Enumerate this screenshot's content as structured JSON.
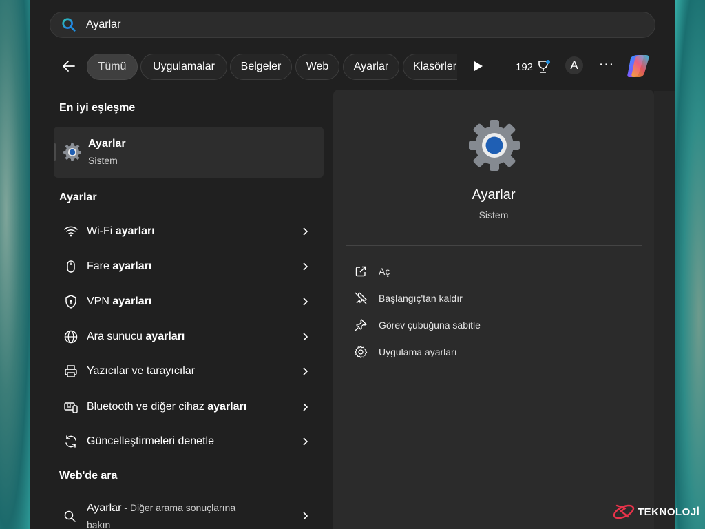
{
  "search": {
    "value": "Ayarlar",
    "icon": "search-icon"
  },
  "filters": {
    "tabs": [
      {
        "label": "Tümü",
        "active": true
      },
      {
        "label": "Uygulamalar"
      },
      {
        "label": "Belgeler"
      },
      {
        "label": "Web"
      },
      {
        "label": "Ayarlar"
      },
      {
        "label": "Klasörler"
      }
    ],
    "points": "192",
    "avatar_letter": "A"
  },
  "results": {
    "best_match_title": "En iyi eşleşme",
    "best_match": {
      "name": "Ayarlar",
      "subtitle": "Sistem"
    },
    "settings_title": "Ayarlar",
    "settings_items": [
      {
        "pre": "Wi-Fi ",
        "bold": "ayarları",
        "icon": "wifi-icon"
      },
      {
        "pre": "Fare ",
        "bold": "ayarları",
        "icon": "mouse-icon"
      },
      {
        "pre": "VPN ",
        "bold": "ayarları",
        "icon": "vpn-shield-icon"
      },
      {
        "pre": "Ara sunucu ",
        "bold": "ayarları",
        "icon": "globe-icon"
      },
      {
        "pre": "Yazıcılar ve tarayıcılar",
        "bold": "",
        "icon": "printer-icon"
      },
      {
        "pre": "Bluetooth ve diğer cihaz ",
        "bold": "ayarları",
        "icon": "bluetooth-devices-icon"
      },
      {
        "pre": "Güncelleştirmeleri denetle",
        "bold": "",
        "icon": "update-icon"
      }
    ],
    "web_title": "Web'de ara",
    "web_item": {
      "query": "Ayarlar",
      "suffix": " - Diğer arama sonuçlarına",
      "line2": "bakın"
    }
  },
  "detail": {
    "title": "Ayarlar",
    "subtitle": "Sistem",
    "actions": [
      {
        "label": "Aç",
        "icon": "open-external-icon"
      },
      {
        "label": "Başlangıç'tan kaldır",
        "icon": "unpin-icon"
      },
      {
        "label": "Görev çubuğuna sabitle",
        "icon": "pin-icon"
      },
      {
        "label": "Uygulama ayarları",
        "icon": "gear-icon"
      }
    ]
  },
  "watermark": {
    "text": "TEKNOLOJİ"
  },
  "colors": {
    "panel": "#202020",
    "accent_blue": "#1f5fb4",
    "gear_gray": "#8a8f96"
  }
}
